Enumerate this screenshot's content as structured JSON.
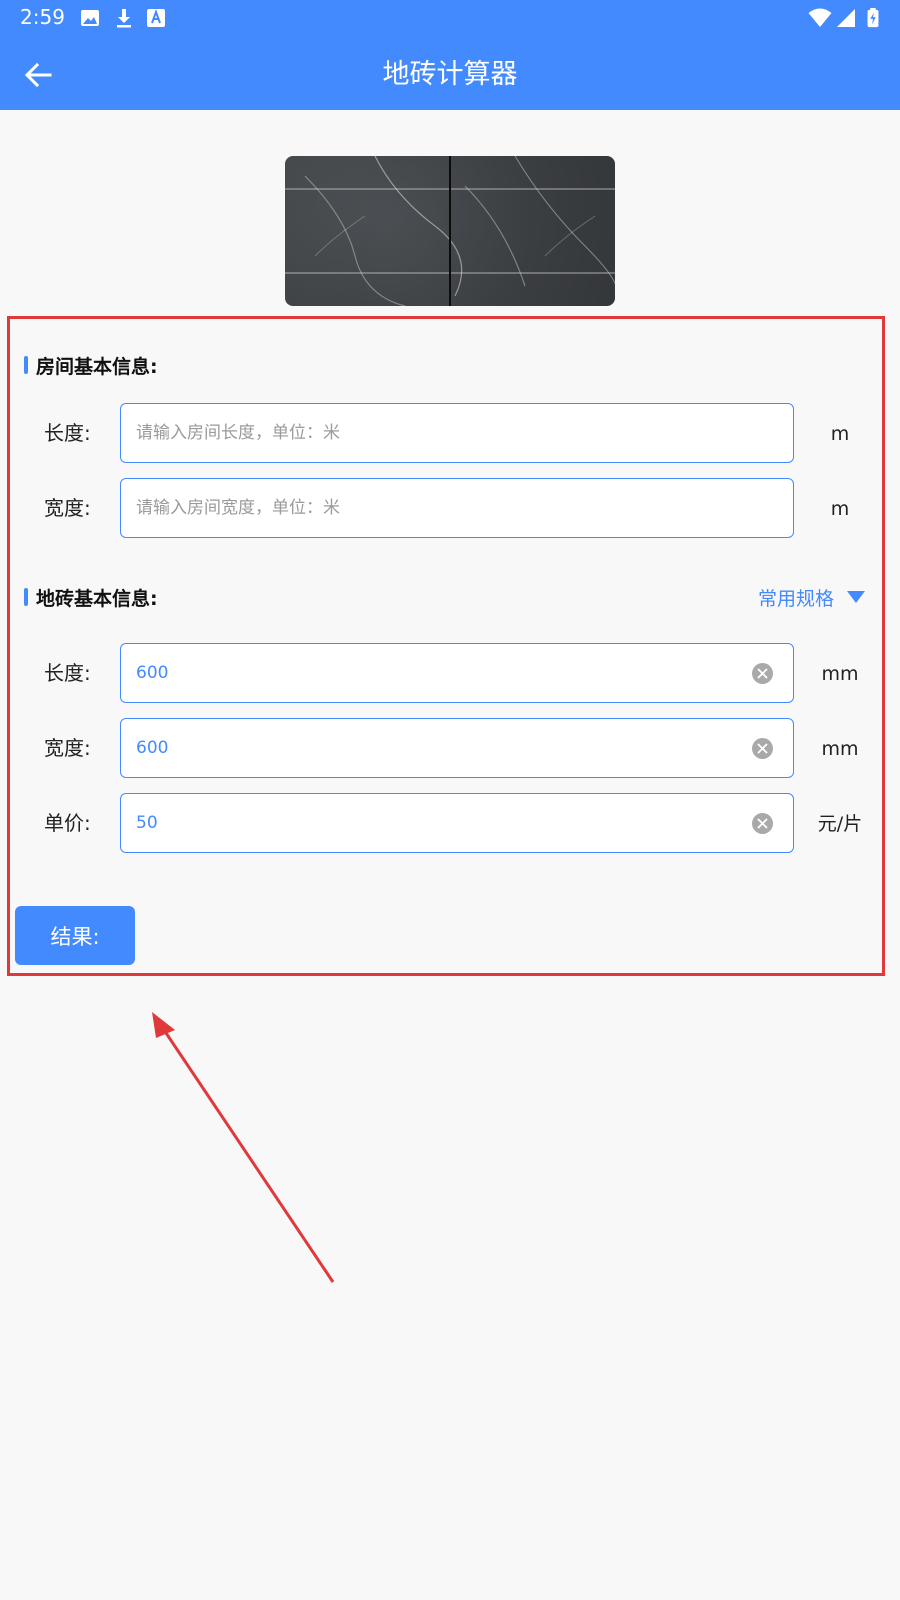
{
  "status_bar": {
    "time": "2:59",
    "left_icons": [
      "image-icon",
      "download-icon",
      "font-a-icon"
    ],
    "right_icons": [
      "wifi-icon",
      "signal-icon",
      "battery-charging-icon"
    ]
  },
  "app_bar": {
    "title": "地砖计算器",
    "back_icon": "back-arrow-icon",
    "color": "#448aff"
  },
  "room_section": {
    "title": "房间基本信息:",
    "length": {
      "label": "长度:",
      "placeholder": "请输入房间长度，单位：米",
      "value": "",
      "unit": "m"
    },
    "width": {
      "label": "宽度:",
      "placeholder": "请输入房间宽度，单位：米",
      "value": "",
      "unit": "m"
    }
  },
  "tile_section": {
    "title": "地砖基本信息:",
    "spec_selector": "常用规格",
    "length": {
      "label": "长度:",
      "value": "600",
      "unit": "mm"
    },
    "width": {
      "label": "宽度:",
      "value": "600",
      "unit": "mm"
    },
    "price": {
      "label": "单价:",
      "value": "50",
      "unit": "元/片"
    }
  },
  "result_button": {
    "label": "结果:"
  },
  "annotation_color": "#e0393c"
}
